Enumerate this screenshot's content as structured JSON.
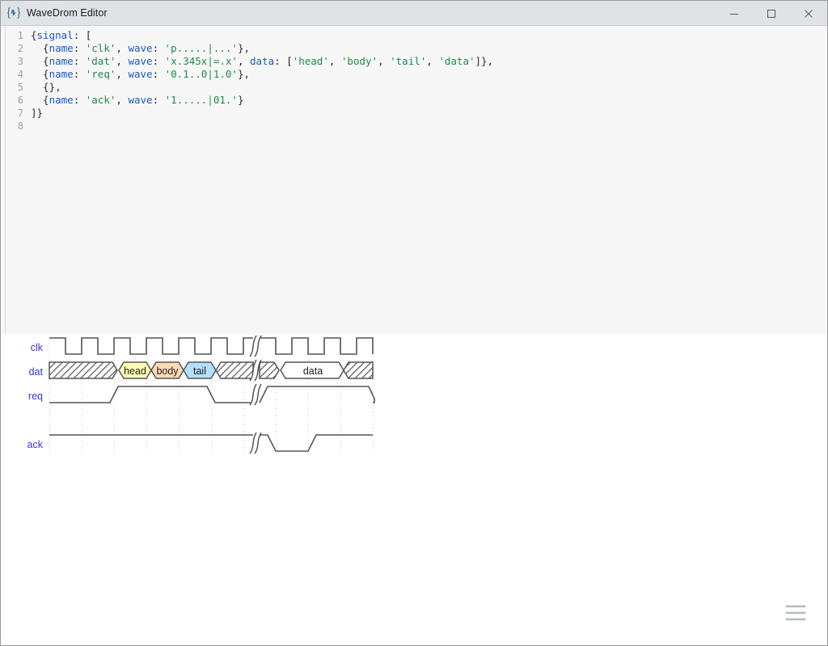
{
  "window": {
    "title": "WaveDrom Editor",
    "icon": "wavedrom-logo-icon",
    "controls": {
      "minimize": "–",
      "maximize": "□",
      "close": "×"
    }
  },
  "editor": {
    "line_numbers": [
      "1",
      "2",
      "3",
      "4",
      "5",
      "6",
      "7",
      "8"
    ],
    "lines": [
      [
        {
          "t": "{",
          "c": "tok-brace"
        },
        {
          "t": "signal",
          "c": "tok-key"
        },
        {
          "t": ": [",
          "c": "tok-punct"
        }
      ],
      [
        {
          "t": "  {",
          "c": "tok-brace"
        },
        {
          "t": "name",
          "c": "tok-key"
        },
        {
          "t": ": ",
          "c": "tok-punct"
        },
        {
          "t": "'clk'",
          "c": "tok-str"
        },
        {
          "t": ", ",
          "c": "tok-punct"
        },
        {
          "t": "wave",
          "c": "tok-key"
        },
        {
          "t": ": ",
          "c": "tok-punct"
        },
        {
          "t": "'p.....|...'",
          "c": "tok-str"
        },
        {
          "t": "},",
          "c": "tok-brace"
        }
      ],
      [
        {
          "t": "  {",
          "c": "tok-brace"
        },
        {
          "t": "name",
          "c": "tok-key"
        },
        {
          "t": ": ",
          "c": "tok-punct"
        },
        {
          "t": "'dat'",
          "c": "tok-str"
        },
        {
          "t": ", ",
          "c": "tok-punct"
        },
        {
          "t": "wave",
          "c": "tok-key"
        },
        {
          "t": ": ",
          "c": "tok-punct"
        },
        {
          "t": "'x.345x|=.x'",
          "c": "tok-str"
        },
        {
          "t": ", ",
          "c": "tok-punct"
        },
        {
          "t": "data",
          "c": "tok-key"
        },
        {
          "t": ": [",
          "c": "tok-punct"
        },
        {
          "t": "'head'",
          "c": "tok-str"
        },
        {
          "t": ", ",
          "c": "tok-punct"
        },
        {
          "t": "'body'",
          "c": "tok-str"
        },
        {
          "t": ", ",
          "c": "tok-punct"
        },
        {
          "t": "'tail'",
          "c": "tok-str"
        },
        {
          "t": ", ",
          "c": "tok-punct"
        },
        {
          "t": "'data'",
          "c": "tok-str"
        },
        {
          "t": "]},",
          "c": "tok-brace"
        }
      ],
      [
        {
          "t": "  {",
          "c": "tok-brace"
        },
        {
          "t": "name",
          "c": "tok-key"
        },
        {
          "t": ": ",
          "c": "tok-punct"
        },
        {
          "t": "'req'",
          "c": "tok-str"
        },
        {
          "t": ", ",
          "c": "tok-punct"
        },
        {
          "t": "wave",
          "c": "tok-key"
        },
        {
          "t": ": ",
          "c": "tok-punct"
        },
        {
          "t": "'0.1..0|1.0'",
          "c": "tok-str"
        },
        {
          "t": "},",
          "c": "tok-brace"
        }
      ],
      [
        {
          "t": "  {},",
          "c": "tok-brace"
        }
      ],
      [
        {
          "t": "  {",
          "c": "tok-brace"
        },
        {
          "t": "name",
          "c": "tok-key"
        },
        {
          "t": ": ",
          "c": "tok-punct"
        },
        {
          "t": "'ack'",
          "c": "tok-str"
        },
        {
          "t": ", ",
          "c": "tok-punct"
        },
        {
          "t": "wave",
          "c": "tok-key"
        },
        {
          "t": ": ",
          "c": "tok-punct"
        },
        {
          "t": "'1.....|01.'",
          "c": "tok-str"
        },
        {
          "t": "}",
          "c": "tok-brace"
        }
      ],
      [
        {
          "t": "]}",
          "c": "tok-brace"
        }
      ],
      []
    ],
    "source_text": "{signal: [\n  {name: 'clk', wave: 'p.....|...'},\n  {name: 'dat', wave: 'x.345x|=.x', data: ['head', 'body', 'tail', 'data']},\n  {name: 'req', wave: '0.1..0|1.0'},\n  {},\n  {name: 'ack', wave: '1.....|01.'}\n]}\n"
  },
  "diagram": {
    "signals": [
      {
        "name": "clk",
        "wave": "p.....|...",
        "label_color": "#3636d8"
      },
      {
        "name": "dat",
        "wave": "x.345x|=.x",
        "data": [
          "head",
          "body",
          "tail",
          "data"
        ],
        "label_color": "#3636d8"
      },
      {
        "name": "req",
        "wave": "0.1..0|1.0",
        "label_color": "#3636d8"
      },
      {
        "name": "",
        "wave": "",
        "label_color": "#3636d8"
      },
      {
        "name": "ack",
        "wave": "1.....|01.",
        "label_color": "#3636d8"
      }
    ],
    "bus_colors": {
      "head": "#ffffb4",
      "body": "#ffd9b4",
      "tail": "#b4e0ff",
      "data": "#ffffff"
    },
    "stroke_color": "#555555",
    "gridline_color": "#cccccc"
  },
  "footer": {
    "menu_icon": "hamburger-menu-icon"
  }
}
